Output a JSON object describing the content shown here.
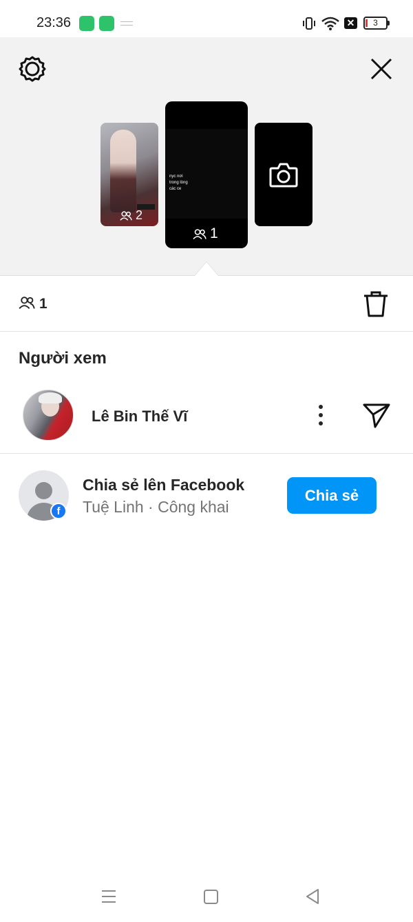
{
  "status_bar": {
    "time": "23:36",
    "battery": "3",
    "icons": [
      "app-icon",
      "app-icon",
      "vibrate-icon",
      "wifi-icon",
      "no-sim-icon",
      "battery-icon"
    ]
  },
  "header": {
    "settings_icon": "gear-icon",
    "close_icon": "close-icon"
  },
  "stories": [
    {
      "viewers": "2",
      "caption": "",
      "icon": "people-icon"
    },
    {
      "viewers": "1",
      "caption": "nyc nơi\ntrong lòng\ncác ce",
      "icon": "people-icon"
    },
    {
      "icon": "camera-icon"
    }
  ],
  "viewer_summary": {
    "count": "1",
    "delete_icon": "trash-icon"
  },
  "viewers_section": {
    "title": "Người xem",
    "items": [
      {
        "name": "Lê Bin Thế Vĩ",
        "menu_icon": "more-icon",
        "send_icon": "send-icon"
      }
    ]
  },
  "share": {
    "title": "Chia sẻ lên Facebook",
    "subtitle": "Tuệ Linh · Công khai",
    "button_label": "Chia sẻ",
    "fb_glyph": "f"
  },
  "nav": {
    "icons": [
      "menu-icon",
      "home-icon",
      "back-icon"
    ]
  },
  "colors": {
    "accent": "#0095f6",
    "facebook": "#1877f2",
    "header_bg": "#f2f2f2"
  }
}
